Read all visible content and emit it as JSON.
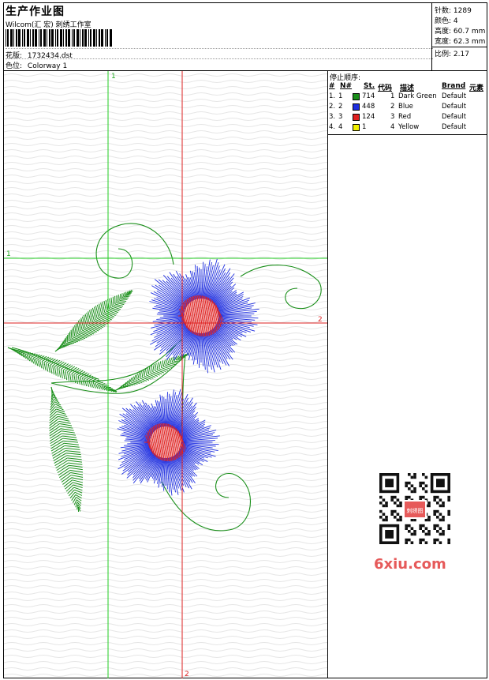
{
  "header": {
    "title": "生产作业图",
    "studio": "Wilcom(汇 宏) 刺绣工作室",
    "design": {
      "label": "花版:",
      "value": "1732434.dst"
    },
    "colorway": {
      "label": "色位:",
      "value": "Colorway 1"
    }
  },
  "stats": [
    {
      "label": "针数:",
      "value": "1289"
    },
    {
      "label": "颜色:",
      "value": "4"
    },
    {
      "label": "高度:",
      "value": "60.7 mm"
    },
    {
      "label": "宽度:",
      "value": "62.3 mm"
    },
    {
      "label": "比例:",
      "value": "2.17"
    }
  ],
  "guides": {
    "vertical_green": "1",
    "horizontal_green": "1",
    "horizontal_red": "2",
    "vertical_red": "2"
  },
  "stop_sequence": {
    "title": "停止顺序:",
    "columns": [
      "#",
      "N#",
      "St.",
      "代码",
      "描述",
      "Brand",
      "元素"
    ],
    "rows": [
      {
        "idx": "1.",
        "n": "1",
        "color": "#1a8f1a",
        "st": "714",
        "code": "1",
        "desc": "Dark Green",
        "brand": "Default"
      },
      {
        "idx": "2.",
        "n": "2",
        "color": "#1e2ee0",
        "st": "448",
        "code": "2",
        "desc": "Blue",
        "brand": "Default"
      },
      {
        "idx": "3.",
        "n": "3",
        "color": "#e02020",
        "st": "124",
        "code": "3",
        "desc": "Red",
        "brand": "Default"
      },
      {
        "idx": "4.",
        "n": "4",
        "color": "#f0f000",
        "st": "1",
        "code": "4",
        "desc": "Yellow",
        "brand": "Default"
      }
    ]
  },
  "watermark": {
    "site": "6xiu.com",
    "stamp_text": "刺绣图"
  },
  "colors": {
    "green": "#1a8f1a",
    "blue": "#1e2ee0",
    "red": "#e02020",
    "guide_green": "#22cc22",
    "guide_red": "#dd2222"
  }
}
